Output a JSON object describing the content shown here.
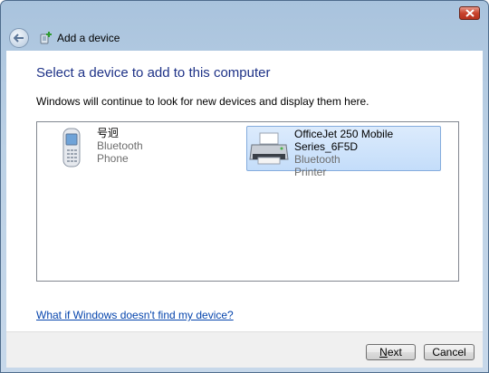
{
  "window": {
    "title": "Add a device",
    "close_icon": "close-icon",
    "back_icon": "back-arrow-icon",
    "title_icon": "add-device-icon"
  },
  "main": {
    "heading": "Select a device to add to this computer",
    "subtext": "Windows will continue to look for new devices and display them here.",
    "devices": [
      {
        "name": "号迥",
        "type": "Bluetooth",
        "category": "Phone",
        "icon": "mobile-phone-icon",
        "selected": false
      },
      {
        "name": "OfficeJet 250 Mobile Series_6F5D",
        "type": "Bluetooth",
        "category": "Printer",
        "icon": "printer-icon",
        "selected": true
      }
    ],
    "help_link": "What if Windows doesn't find my device?"
  },
  "footer": {
    "next_label": "Next",
    "cancel_label": "Cancel"
  },
  "colors": {
    "heading": "#1e3287",
    "link": "#0645ad",
    "selection": "#c4ddfa"
  }
}
